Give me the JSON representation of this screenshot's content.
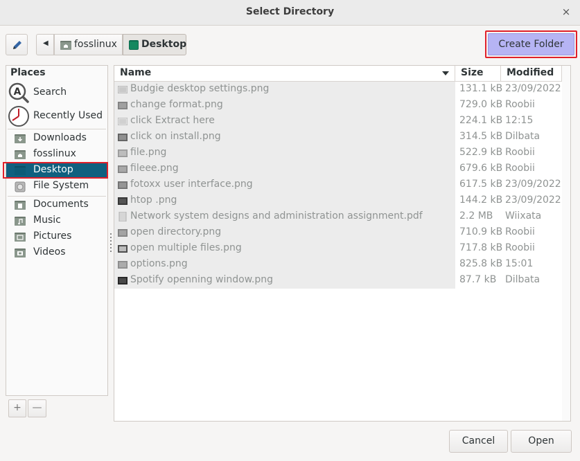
{
  "window": {
    "title": "Select Directory",
    "close_glyph": "×"
  },
  "toolbar": {
    "edit_icon": "pencil-icon",
    "path": [
      {
        "label": "fosslinux",
        "icon": "home-folder-icon"
      },
      {
        "label": "Desktop",
        "icon": "desktop-folder-icon"
      }
    ],
    "create_folder_label": "Create Folder"
  },
  "places": {
    "header": "Places",
    "items": [
      {
        "label": "Search",
        "icon": "search-icon"
      },
      {
        "label": "Recently Used",
        "icon": "clock-icon"
      },
      {
        "label": "Downloads",
        "icon": "downloads-folder-icon"
      },
      {
        "label": "fosslinux",
        "icon": "home-folder-icon"
      },
      {
        "label": "Desktop",
        "icon": "desktop-folder-icon",
        "selected": true
      },
      {
        "label": "File System",
        "icon": "drive-icon"
      },
      {
        "label": "Documents",
        "icon": "documents-folder-icon"
      },
      {
        "label": "Music",
        "icon": "music-folder-icon"
      },
      {
        "label": "Pictures",
        "icon": "pictures-folder-icon"
      },
      {
        "label": "Videos",
        "icon": "videos-folder-icon"
      }
    ],
    "add_glyph": "+",
    "remove_glyph": "—"
  },
  "files": {
    "columns": {
      "name": "Name",
      "size": "Size",
      "modified": "Modified"
    },
    "rows": [
      {
        "name": "Budgie desktop settings.png",
        "size": "131.1 kB",
        "modified": "23/09/2022"
      },
      {
        "name": "change format.png",
        "size": "729.0 kB",
        "modified": "Roobii"
      },
      {
        "name": "click Extract here",
        "size": "224.1 kB",
        "modified": "12:15"
      },
      {
        "name": "click on install.png",
        "size": "314.5 kB",
        "modified": "Dilbata"
      },
      {
        "name": "file.png",
        "size": "522.9 kB",
        "modified": "Roobii"
      },
      {
        "name": "fileee.png",
        "size": "679.6 kB",
        "modified": "Roobii"
      },
      {
        "name": "fotoxx user interface.png",
        "size": "617.5 kB",
        "modified": "23/09/2022"
      },
      {
        "name": "htop .png",
        "size": "144.2 kB",
        "modified": "23/09/2022"
      },
      {
        "name": "Network system designs and administration assignment.pdf",
        "size": "2.2 MB",
        "modified": "Wiixata"
      },
      {
        "name": "open directory.png",
        "size": "710.9 kB",
        "modified": "Roobii"
      },
      {
        "name": "open multiple files.png",
        "size": "717.8 kB",
        "modified": "Roobii"
      },
      {
        "name": "options.png",
        "size": "825.8 kB",
        "modified": "15:01"
      },
      {
        "name": "Spotify openning window.png",
        "size": "87.7 kB",
        "modified": "Dilbata"
      }
    ]
  },
  "actions": {
    "cancel_label": "Cancel",
    "open_label": "Open"
  },
  "colors": {
    "accent": "#10607f",
    "highlight": "#e0202a",
    "create_folder_bg": "#b6b4f4"
  }
}
